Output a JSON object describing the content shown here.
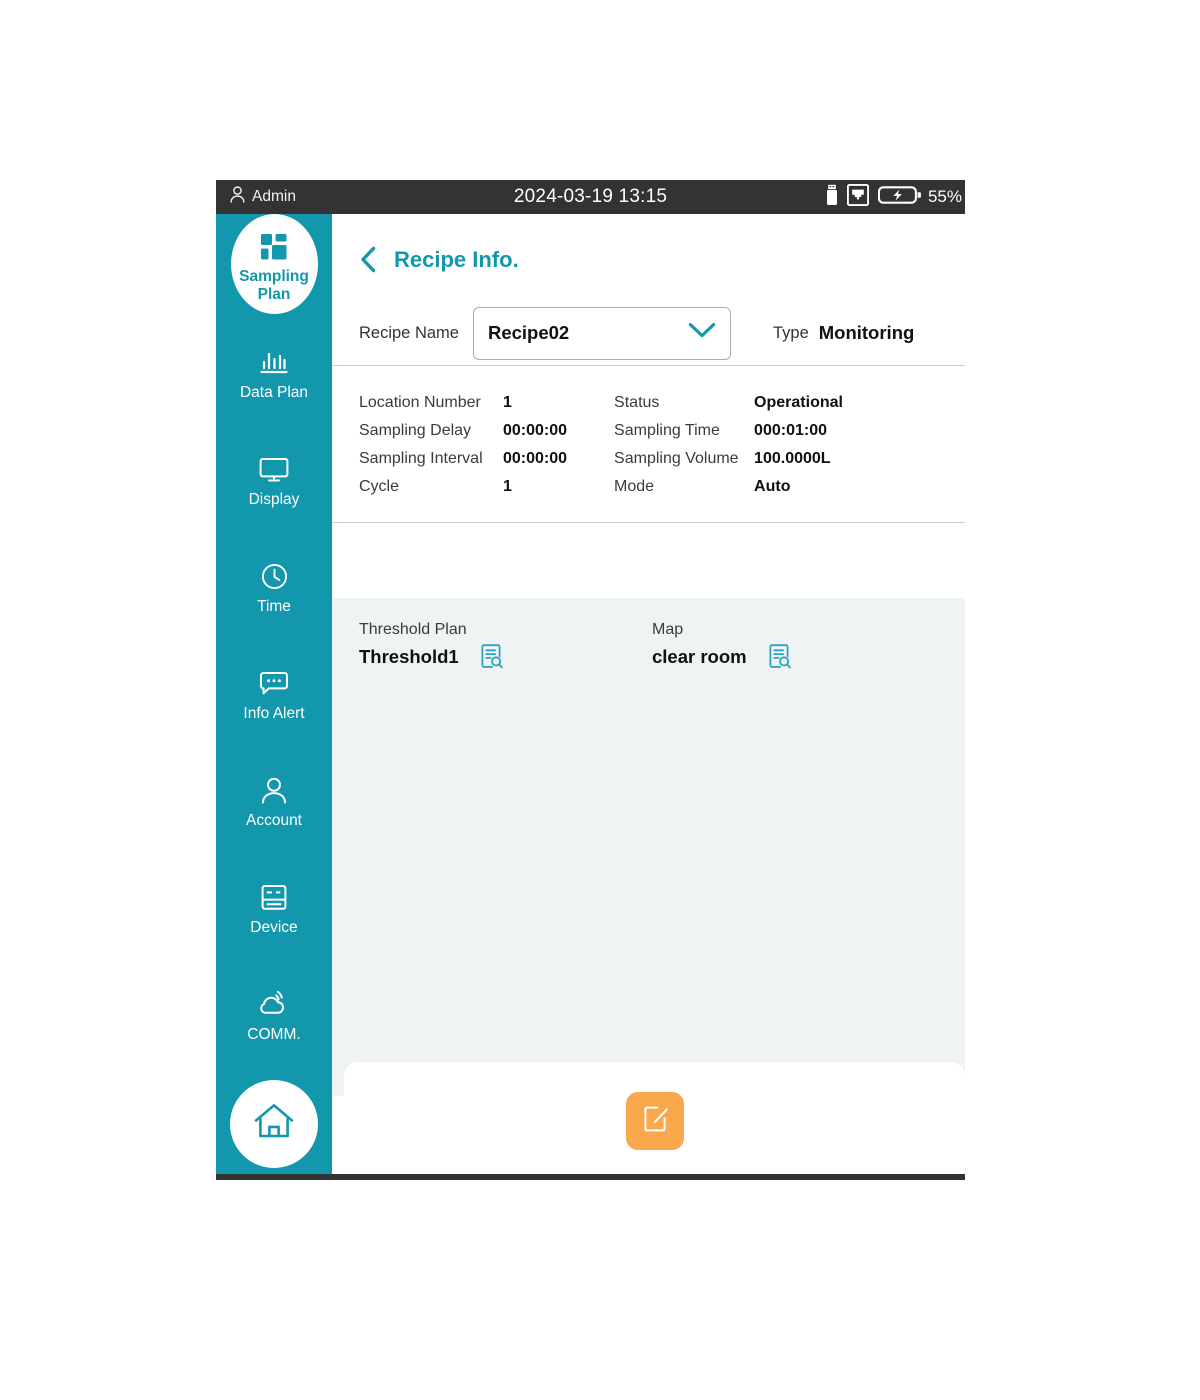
{
  "statusbar": {
    "user": "Admin",
    "user_icon": "person-icon",
    "datetime": "2024-03-19 13:15",
    "usb_icon": "usb-drive-icon",
    "network_icon": "ethernet-icon",
    "battery_icon": "battery-charging-icon",
    "battery_text": "55%"
  },
  "sidebar": {
    "accent": "#1297ac",
    "items": [
      {
        "label": "Sampling\nPlan",
        "label_line1": "Sampling",
        "label_line2": "Plan",
        "icon": "grid-tiles-icon",
        "active": true
      },
      {
        "label": "Data Plan",
        "icon": "bar-chart-icon",
        "active": false
      },
      {
        "label": "Display",
        "icon": "monitor-icon",
        "active": false
      },
      {
        "label": "Time",
        "icon": "clock-icon",
        "active": false
      },
      {
        "label": "Info Alert",
        "icon": "chat-bubble-icon",
        "active": false
      },
      {
        "label": "Account",
        "icon": "person-icon",
        "active": false
      },
      {
        "label": "Device",
        "icon": "device-rack-icon",
        "active": false
      },
      {
        "label": "COMM.",
        "icon": "cloud-signal-icon",
        "active": false
      }
    ],
    "home_button": {
      "icon": "home-icon",
      "label": "home-button"
    }
  },
  "header": {
    "back_icon": "chevron-left-icon",
    "title": "Recipe Info."
  },
  "recipe_row": {
    "name_label": "Recipe Name",
    "name_value": "Recipe02",
    "dropdown_icon": "chevron-down-icon",
    "type_label": "Type",
    "type_value": "Monitoring"
  },
  "params": {
    "left": [
      {
        "key": "Location Number",
        "value": "1"
      },
      {
        "key": "Sampling Delay",
        "value": "00:00:00"
      },
      {
        "key": "Sampling Interval",
        "value": "00:00:00"
      },
      {
        "key": "Cycle",
        "value": "1"
      }
    ],
    "right": [
      {
        "key": "Status",
        "value": "Operational"
      },
      {
        "key": "Sampling Time",
        "value": "000:01:00"
      },
      {
        "key": "Sampling Volume",
        "value": "100.0000L"
      },
      {
        "key": "Mode",
        "value": "Auto"
      }
    ]
  },
  "panel": {
    "groups": [
      {
        "label": "Threshold Plan",
        "value": "Threshold1",
        "icon": "document-search-icon"
      },
      {
        "label": "Map",
        "value": "clear room",
        "icon": "document-search-icon"
      }
    ]
  },
  "action_bar": {
    "edit_button_icon": "edit-document-icon",
    "edit_button_color": "#f9a84d"
  }
}
